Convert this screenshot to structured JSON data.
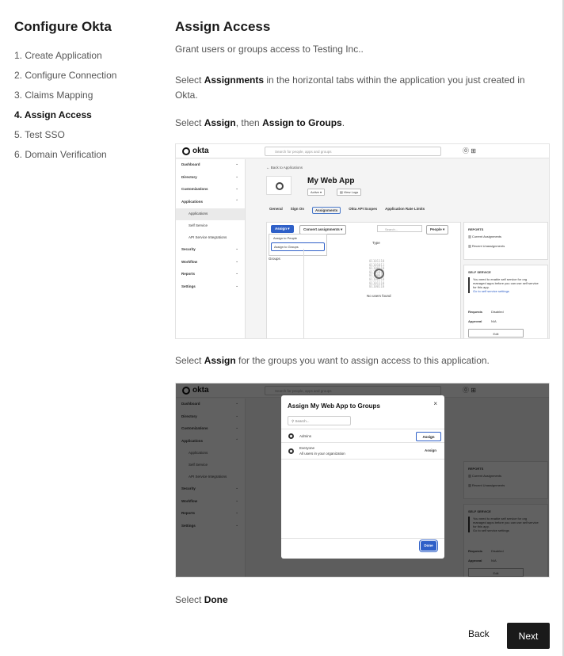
{
  "sidebar": {
    "title": "Configure Okta",
    "steps": [
      "1. Create Application",
      "2. Configure Connection",
      "3. Claims Mapping",
      "4. Assign Access",
      "5. Test SSO",
      "6. Domain Verification"
    ]
  },
  "main": {
    "title": "Assign Access",
    "intro": "Grant users or groups access to Testing Inc..",
    "p1_pre": "Select ",
    "p1_bold": "Assignments",
    "p1_post": " in the horizontal tabs within the application you just created in Okta.",
    "p2_pre": "Select ",
    "p2_bold1": "Assign",
    "p2_mid": ", then ",
    "p2_bold2": "Assign to Groups",
    "p2_post": ".",
    "p3_pre": "Select ",
    "p3_bold": "Assign",
    "p3_post": " for the groups you want to assign access to this application.",
    "p4_pre": "Select ",
    "p4_bold": "Done"
  },
  "okta": {
    "logo": "okta",
    "search_placeholder": "Search for people, apps and groups",
    "nav": [
      {
        "label": "Dashboard",
        "chevron": "⌄"
      },
      {
        "label": "Directory",
        "chevron": "⌄"
      },
      {
        "label": "Customizations",
        "chevron": "⌄"
      },
      {
        "label": "Applications",
        "chevron": "⌃"
      }
    ],
    "nav_sub": [
      "Applications",
      "Self Service",
      "API Service Integrations"
    ],
    "nav_after": [
      {
        "label": "Security",
        "chevron": "⌄"
      },
      {
        "label": "Workflow",
        "chevron": "⌄"
      },
      {
        "label": "Reports",
        "chevron": "⌄"
      },
      {
        "label": "Settings",
        "chevron": "⌄"
      }
    ],
    "back_link": "← Back to Applications",
    "app_name": "My Web App",
    "active_label": "Active ▾",
    "view_logs": "View Logs",
    "tabs": [
      "General",
      "Sign On",
      "Assignments",
      "Okta API Scopes",
      "Application Rate Limits"
    ],
    "assign_btn": "Assign ▾",
    "convert_btn": "Convert assignments ▾",
    "filter_search": "Search...",
    "people_btn": "People ▾",
    "dropdown": [
      "Assign to People",
      "Assign to Groups"
    ],
    "type_col": "Type",
    "groups_label": "Groups",
    "no_users": "No users found",
    "reports_title": "REPORTS",
    "reports_items": [
      "Current Assignments",
      "Recent Unassignments"
    ],
    "self_service_title": "SELF SERVICE",
    "self_service_text": "You need to enable self service for org managed apps before you can use self service for this app.",
    "self_service_link": "Go to self service settings",
    "requests_label": "Requests",
    "requests_val": "Disabled",
    "approval_label": "Approval",
    "approval_val": "N/A",
    "edit_btn": "Edit"
  },
  "modal": {
    "title": "Assign My Web App to Groups",
    "close": "×",
    "search_placeholder": "Search...",
    "rows": [
      {
        "name": "Admins",
        "desc": "",
        "action": "Assign"
      },
      {
        "name": "Everyone",
        "desc": "All users in your organization",
        "action": "Assign"
      }
    ],
    "done": "Done"
  },
  "footer": {
    "back": "Back",
    "next": "Next"
  }
}
